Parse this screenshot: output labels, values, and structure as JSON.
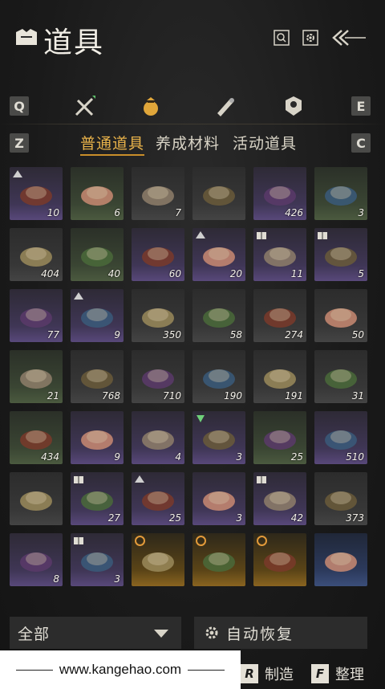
{
  "header": {
    "title": "道具"
  },
  "categories": {
    "key_left": "Q",
    "key_right": "E"
  },
  "subtabs": {
    "key_left": "Z",
    "key_right": "C",
    "items": [
      "普通道具",
      "养成材料",
      "活动道具"
    ]
  },
  "items": [
    {
      "qty": "10",
      "bg": "purple",
      "icon": "stew-bowl-icon",
      "mark": "up-arrow"
    },
    {
      "qty": "6",
      "bg": "green",
      "icon": "pink-flower-icon"
    },
    {
      "qty": "7",
      "bg": "gray",
      "icon": "cloth-bag-icon"
    },
    {
      "qty": "",
      "bg": "gray",
      "icon": "dark-banner-icon"
    },
    {
      "qty": "426",
      "bg": "purple",
      "icon": "spice-box-icon"
    },
    {
      "qty": "3",
      "bg": "green",
      "icon": "pink-herb-icon"
    },
    {
      "qty": "404",
      "bg": "gray",
      "icon": "fish-icon"
    },
    {
      "qty": "40",
      "bg": "green",
      "icon": "white-flower-icon"
    },
    {
      "qty": "60",
      "bg": "purple",
      "icon": "gift-box-icon"
    },
    {
      "qty": "20",
      "bg": "purple",
      "icon": "fried-dish-icon",
      "mark": "up-arrow"
    },
    {
      "qty": "11",
      "bg": "purple",
      "icon": "recipe-scroll-icon",
      "mark": "book"
    },
    {
      "qty": "5",
      "bg": "purple",
      "icon": "blue-scroll-icon",
      "mark": "book"
    },
    {
      "qty": "77",
      "bg": "purple",
      "icon": "horn-icon"
    },
    {
      "qty": "9",
      "bg": "purple",
      "icon": "noodle-bowl-icon",
      "mark": "up-arrow"
    },
    {
      "qty": "350",
      "bg": "gray",
      "icon": "gold-flower-icon"
    },
    {
      "qty": "58",
      "bg": "gray",
      "icon": "mushroom-icon"
    },
    {
      "qty": "274",
      "bg": "gray",
      "icon": "lychee-icon"
    },
    {
      "qty": "50",
      "bg": "gray",
      "icon": "silver-fish-icon"
    },
    {
      "qty": "21",
      "bg": "green",
      "icon": "green-herb-icon"
    },
    {
      "qty": "768",
      "bg": "gray",
      "icon": "grain-sack-icon"
    },
    {
      "qty": "710",
      "bg": "gray",
      "icon": "ore-icon"
    },
    {
      "qty": "190",
      "bg": "gray",
      "icon": "firewood-icon"
    },
    {
      "qty": "191",
      "bg": "gray",
      "icon": "eggs-icon"
    },
    {
      "qty": "31",
      "bg": "gray",
      "icon": "meat-icon"
    },
    {
      "qty": "434",
      "bg": "green",
      "icon": "leaf-herb-icon"
    },
    {
      "qty": "9",
      "bg": "purple",
      "icon": "cabinet-icon"
    },
    {
      "qty": "4",
      "bg": "purple",
      "icon": "chest-icon"
    },
    {
      "qty": "3",
      "bg": "purple",
      "icon": "braised-dish-icon",
      "mark": "sparkle"
    },
    {
      "qty": "25",
      "bg": "green",
      "icon": "fabric-bolt-icon"
    },
    {
      "qty": "510",
      "bg": "purple",
      "icon": "wine-jar-icon"
    },
    {
      "qty": "",
      "bg": "gray",
      "icon": "clay-pot-icon"
    },
    {
      "qty": "27",
      "bg": "purple",
      "icon": "paper-note-icon",
      "mark": "book"
    },
    {
      "qty": "25",
      "bg": "purple",
      "icon": "buns-basket-icon",
      "mark": "up-arrow"
    },
    {
      "qty": "3",
      "bg": "purple",
      "icon": "dark-gift-box-icon"
    },
    {
      "qty": "42",
      "bg": "purple",
      "icon": "paper-note-icon",
      "mark": "book"
    },
    {
      "qty": "373",
      "bg": "gray",
      "icon": "arrows-icon"
    },
    {
      "qty": "8",
      "bg": "purple",
      "icon": "rice-dish-icon"
    },
    {
      "qty": "3",
      "bg": "purple",
      "icon": "crystal-icon",
      "mark": "book"
    },
    {
      "qty": "",
      "bg": "gold",
      "icon": "red-card-icon",
      "mark": "clock"
    },
    {
      "qty": "",
      "bg": "gold",
      "icon": "red-card-icon",
      "mark": "clock"
    },
    {
      "qty": "",
      "bg": "gold",
      "icon": "red-card-icon",
      "mark": "clock"
    },
    {
      "qty": "",
      "bg": "blue",
      "icon": "blue-card-icon"
    }
  ],
  "bottom": {
    "filter_label": "全部",
    "auto_label": "自动恢复"
  },
  "watermark": {
    "text": "www.kangehao.com"
  },
  "actions": [
    {
      "key": "R",
      "label": "制造"
    },
    {
      "key": "F",
      "label": "整理"
    }
  ],
  "colors": {
    "accent": "#e8b24a",
    "purple_bg": "#58487a",
    "green_bg": "#4b5a3f",
    "gold_bg": "#8a6420"
  }
}
